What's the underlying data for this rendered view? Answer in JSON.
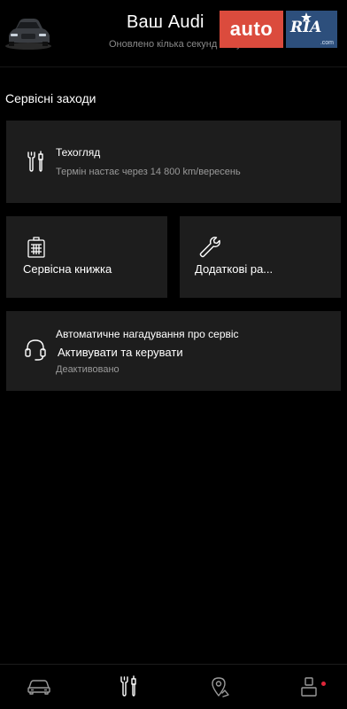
{
  "header": {
    "title": "Ваш Audi",
    "subtitle": "Оновлено кілька секунд тому",
    "car_image": "audi-car-thumbnail"
  },
  "watermark": {
    "auto": "auto",
    "ria": "RIA",
    "dotcom": ".com",
    "colors": {
      "auto_bg": "#db4b3d",
      "ria_bg": "#2d4f7c"
    }
  },
  "section": {
    "title": "Сервісні заходи"
  },
  "cards": {
    "inspection": {
      "icon": "wrench-screwdriver-icon",
      "title": "Техогляд",
      "subtitle": "Термін настає через 14 800 km/вересень"
    },
    "service_book": {
      "icon": "service-book-icon",
      "label": "Сервісна книжка"
    },
    "additional": {
      "icon": "wrench-icon",
      "label": "Додаткові ра..."
    },
    "reminder": {
      "icon": "headset-icon",
      "title": "Автоматичне нагадування про сервіс",
      "action": "Активувати та керувати",
      "status": "Деактивовано"
    }
  },
  "bottom_nav": {
    "items": [
      {
        "name": "car",
        "icon": "car-icon"
      },
      {
        "name": "service",
        "icon": "wrench-screwdriver-icon",
        "active": true
      },
      {
        "name": "map",
        "icon": "map-pin-icon"
      },
      {
        "name": "profile",
        "icon": "user-icon",
        "notification": true
      }
    ],
    "colors": {
      "active": "#ffffff",
      "inactive": "#9a9a9a",
      "notification_dot": "#e0263a"
    }
  }
}
